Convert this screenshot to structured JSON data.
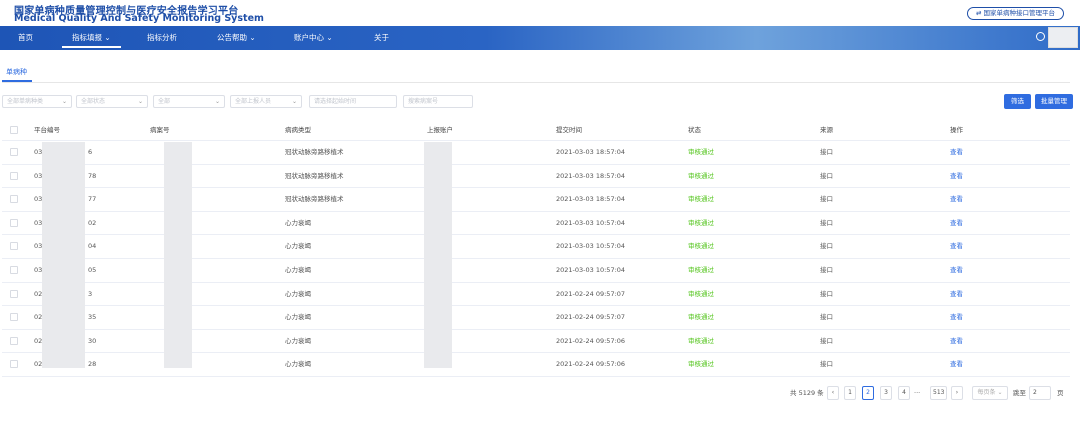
{
  "header": {
    "title_cn": "国家单病种质量管理控制与医疗安全报告学习平台",
    "title_en": "Medical Quality And Safety Monitoring System",
    "platform_button": "⇄ 国家单病种接口管理平台"
  },
  "nav": {
    "items": [
      "首页",
      "指标填报 ⌄",
      "指标分析",
      "公告帮助 ⌄",
      "账户中心 ⌄",
      "关于"
    ],
    "active_index": 1
  },
  "tab": {
    "label": "单病种"
  },
  "filters": {
    "disease": "全部单病种类",
    "status": "全部状态",
    "all": "全部",
    "reporter": "全部上报人员",
    "date": "请选择起始时间",
    "search_placeholder": "搜索病案号",
    "chevron": "⌄"
  },
  "buttons": {
    "filter": "筛选",
    "batch": "批量管理"
  },
  "table": {
    "headers": [
      "平台编号",
      "病案号",
      "病病类型",
      "上报账户",
      "提交时间",
      "状态",
      "来源",
      "操作"
    ],
    "rows": [
      {
        "id_prefix": "03",
        "id_suffix": "6",
        "type": "冠状动脉旁路移植术",
        "time": "2021-03-03 18:57:04",
        "status": "审核通过",
        "source": "接口",
        "action": "查看"
      },
      {
        "id_prefix": "03",
        "id_suffix": "78",
        "type": "冠状动脉旁路移植术",
        "time": "2021-03-03 18:57:04",
        "status": "审核通过",
        "source": "接口",
        "action": "查看"
      },
      {
        "id_prefix": "03",
        "id_suffix": "77",
        "type": "冠状动脉旁路移植术",
        "time": "2021-03-03 18:57:04",
        "status": "审核通过",
        "source": "接口",
        "action": "查看"
      },
      {
        "id_prefix": "03",
        "id_suffix": "02",
        "type": "心力衰竭",
        "time": "2021-03-03 10:57:04",
        "status": "审核通过",
        "source": "接口",
        "action": "查看"
      },
      {
        "id_prefix": "03",
        "id_suffix": "04",
        "type": "心力衰竭",
        "time": "2021-03-03 10:57:04",
        "status": "审核通过",
        "source": "接口",
        "action": "查看"
      },
      {
        "id_prefix": "03",
        "id_suffix": "05",
        "type": "心力衰竭",
        "time": "2021-03-03 10:57:04",
        "status": "审核通过",
        "source": "接口",
        "action": "查看"
      },
      {
        "id_prefix": "02",
        "id_suffix": "3",
        "type": "心力衰竭",
        "time": "2021-02-24 09:57:07",
        "status": "审核通过",
        "source": "接口",
        "action": "查看"
      },
      {
        "id_prefix": "02",
        "id_suffix": "35",
        "type": "心力衰竭",
        "time": "2021-02-24 09:57:07",
        "status": "审核通过",
        "source": "接口",
        "action": "查看"
      },
      {
        "id_prefix": "02",
        "id_suffix": "30",
        "type": "心力衰竭",
        "time": "2021-02-24 09:57:06",
        "status": "审核通过",
        "source": "接口",
        "action": "查看"
      },
      {
        "id_prefix": "02",
        "id_suffix": "28",
        "type": "心力衰竭",
        "time": "2021-02-24 09:57:06",
        "status": "审核通过",
        "source": "接口",
        "action": "查看"
      }
    ]
  },
  "pagination": {
    "total": "共 5129 条",
    "prev": "‹",
    "pages": [
      "1",
      "2",
      "3",
      "4"
    ],
    "active_page": "2",
    "ellipsis": "···",
    "last": "513",
    "next": "›",
    "page_size": "每页条 ⌄",
    "goto_label": "跳至",
    "goto_value": "2",
    "goto_suffix": "页"
  },
  "colors": {
    "primary": "#2f6ce0",
    "nav": "#1e55b6",
    "success": "#52c41a"
  }
}
